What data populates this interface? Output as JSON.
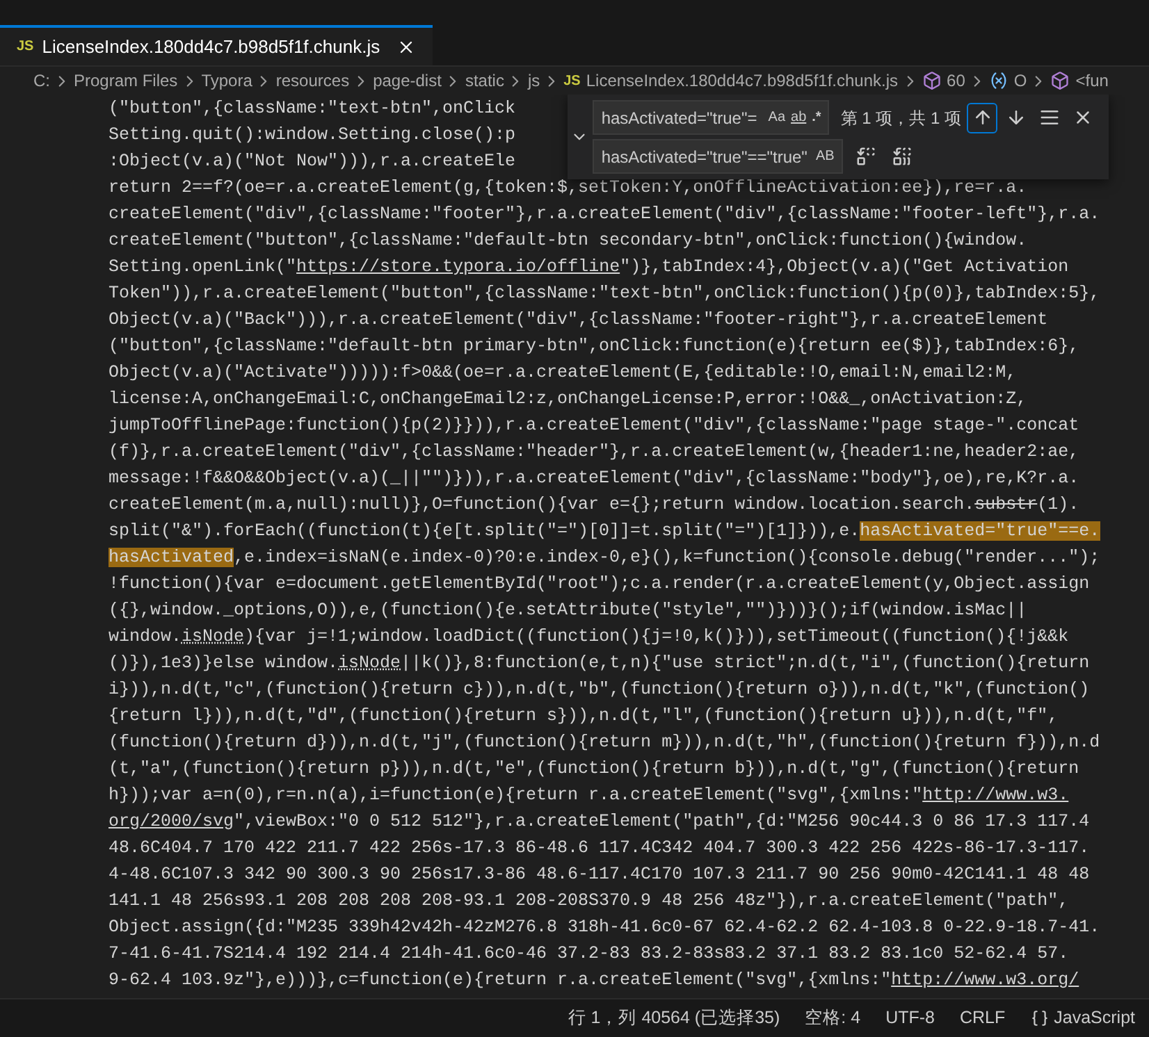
{
  "tab": {
    "label": "LicenseIndex.180dd4c7.b98d5f1f.chunk.js",
    "badge": "JS",
    "selected": true
  },
  "breadcrumbs": [
    {
      "label": "C:",
      "kind": "folder"
    },
    {
      "label": "Program Files",
      "kind": "folder"
    },
    {
      "label": "Typora",
      "kind": "folder"
    },
    {
      "label": "resources",
      "kind": "folder"
    },
    {
      "label": "page-dist",
      "kind": "folder"
    },
    {
      "label": "static",
      "kind": "folder"
    },
    {
      "label": "js",
      "kind": "folder"
    },
    {
      "label": "LicenseIndex.180dd4c7.b98d5f1f.chunk.js",
      "kind": "file",
      "badge": "JS"
    },
    {
      "label": "60",
      "kind": "module"
    },
    {
      "label": "O",
      "kind": "variable"
    },
    {
      "label": "<fun",
      "kind": "module"
    }
  ],
  "code_lines": [
    [
      {
        "text": "(\"button\",{className:\"text-btn\",onClick",
        "kind": "plain"
      }
    ],
    [
      {
        "text": "Setting.quit():window.Setting.close():p",
        "kind": "plain"
      }
    ],
    [
      {
        "text": ":Object(v.a)(\"Not Now\"))),r.a.createEle",
        "kind": "plain"
      }
    ],
    [
      {
        "text": "return 2==f?(oe=r.a.createElement(g,{token:$,setToken:Y,onOfflineActivation:ee}),re=r.a.",
        "kind": "plain"
      }
    ],
    [
      {
        "text": "createElement(\"div\",{className:\"footer\"},r.a.createElement(\"div\",{className:\"footer-left\"},r.a.",
        "kind": "plain"
      }
    ],
    [
      {
        "text": "createElement(\"button\",{className:\"default-btn secondary-btn\",onClick:function(){window.",
        "kind": "plain"
      }
    ],
    [
      {
        "text": "Setting.openLink(\"",
        "kind": "plain"
      },
      {
        "text": "https://store.typora.io/offline",
        "kind": "link"
      },
      {
        "text": "\")},tabIndex:4},Object(v.a)(\"Get Activation",
        "kind": "plain"
      }
    ],
    [
      {
        "text": "Token\")),r.a.createElement(\"button\",{className:\"text-btn\",onClick:function(){p(0)},tabIndex:5},",
        "kind": "plain"
      }
    ],
    [
      {
        "text": "Object(v.a)(\"Back\"))),r.a.createElement(\"div\",{className:\"footer-right\"},r.a.createElement",
        "kind": "plain"
      }
    ],
    [
      {
        "text": "(\"button\",{className:\"default-btn primary-btn\",onClick:function(e){return ee($)},tabIndex:6},",
        "kind": "plain"
      }
    ],
    [
      {
        "text": "Object(v.a)(\"Activate\"))))):f>0&&(oe=r.a.createElement(E,{editable:!O,email:N,email2:M,",
        "kind": "plain"
      }
    ],
    [
      {
        "text": "license:A,onChangeEmail:C,onChangeEmail2:z,onChangeLicense:P,error:!O&&_,onActivation:Z,",
        "kind": "plain"
      }
    ],
    [
      {
        "text": "jumpToOfflinePage:function(){p(2)}})),r.a.createElement(\"div\",{className:\"page stage-\".concat",
        "kind": "plain"
      }
    ],
    [
      {
        "text": "(f)},r.a.createElement(\"div\",{className:\"header\"},r.a.createElement(w,{header1:ne,header2:ae,",
        "kind": "plain"
      }
    ],
    [
      {
        "text": "message:!f&&O&&Object(v.a)(_||\"\")})),r.a.createElement(\"div\",{className:\"body\"},oe),re,K?r.a.",
        "kind": "plain"
      }
    ],
    [
      {
        "text": "createElement(m.a,null):null)},O=function(){var e={};return window.location.search.",
        "kind": "plain"
      },
      {
        "text": "substr",
        "kind": "deprecated"
      },
      {
        "text": "(1).",
        "kind": "plain"
      }
    ],
    [
      {
        "text": "split(\"&\").forEach((function(t){e[t.split(\"=\")[0]]=t.split(\"=\")[1]})),e.",
        "kind": "plain"
      },
      {
        "text": "hasActivated=\"true\"==e.",
        "kind": "match"
      }
    ],
    [
      {
        "text": "hasActivated",
        "kind": "match"
      },
      {
        "text": ",e.index=isNaN(e.index-0)?0:e.index-0,e}(),k=function(){console.debug(\"render...\");",
        "kind": "plain"
      }
    ],
    [
      {
        "text": "!function(){var e=document.getElementById(\"root\");c.a.render(r.a.createElement(y,Object.assign",
        "kind": "plain"
      }
    ],
    [
      {
        "text": "({},window._options,O)),e,(function(){e.setAttribute(\"style\",\"\")}))}();if(window.isMac||",
        "kind": "plain"
      }
    ],
    [
      {
        "text": "window.",
        "kind": "plain"
      },
      {
        "text": "isNode",
        "kind": "hint"
      },
      {
        "text": "){var j=!1;window.loadDict((function(){j=!0,k()})),setTimeout((function(){!j&&k",
        "kind": "plain"
      }
    ],
    [
      {
        "text": "()}),1e3)}else window.",
        "kind": "plain"
      },
      {
        "text": "isNode",
        "kind": "hint"
      },
      {
        "text": "||k()},8:function(e,t,n){\"use strict\";n.d(t,\"i\",(function(){return",
        "kind": "plain"
      }
    ],
    [
      {
        "text": "i})),n.d(t,\"c\",(function(){return c})),n.d(t,\"b\",(function(){return o})),n.d(t,\"k\",(function()",
        "kind": "plain"
      }
    ],
    [
      {
        "text": "{return l})),n.d(t,\"d\",(function(){return s})),n.d(t,\"l\",(function(){return u})),n.d(t,\"f\",",
        "kind": "plain"
      }
    ],
    [
      {
        "text": "(function(){return d})),n.d(t,\"j\",(function(){return m})),n.d(t,\"h\",(function(){return f})),n.d",
        "kind": "plain"
      }
    ],
    [
      {
        "text": "(t,\"a\",(function(){return p})),n.d(t,\"e\",(function(){return b})),n.d(t,\"g\",(function(){return",
        "kind": "plain"
      }
    ],
    [
      {
        "text": "h}));var a=n(0),r=n.n(a),i=function(e){return r.a.createElement(\"svg\",{xmlns:\"",
        "kind": "plain"
      },
      {
        "text": "http://www.w3.",
        "kind": "link"
      }
    ],
    [
      {
        "text": "org/2000/svg",
        "kind": "link"
      },
      {
        "text": "\",viewBox:\"0 0 512 512\"},r.a.createElement(\"path\",{d:\"M256 90c44.3 0 86 17.3 117.4",
        "kind": "plain"
      }
    ],
    [
      {
        "text": "48.6C404.7 170 422 211.7 422 256s-17.3 86-48.6 117.4C342 404.7 300.3 422 256 422s-86-17.3-117.",
        "kind": "plain"
      }
    ],
    [
      {
        "text": "4-48.6C107.3 342 90 300.3 90 256s17.3-86 48.6-117.4C170 107.3 211.7 90 256 90m0-42C141.1 48 48",
        "kind": "plain"
      }
    ],
    [
      {
        "text": "141.1 48 256s93.1 208 208 208 208-93.1 208-208S370.9 48 256 48z\"}),r.a.createElement(\"path\",",
        "kind": "plain"
      }
    ],
    [
      {
        "text": "Object.assign({d:\"M235 339h42v42h-42zM276.8 318h-41.6c0-67 62.4-62.2 62.4-103.8 0-22.9-18.7-41.",
        "kind": "plain"
      }
    ],
    [
      {
        "text": "7-41.6-41.7S214.4 192 214.4 214h-41.6c0-46 37.2-83 83.2-83s83.2 37.1 83.2 83.1c0 52-62.4 57.",
        "kind": "plain"
      }
    ],
    [
      {
        "text": "9-62.4 103.9z\"},e)))},c=function(e){return r.a.createElement(\"svg\",{xmlns:\"",
        "kind": "plain"
      },
      {
        "text": "http://www.w3.org/",
        "kind": "link"
      }
    ]
  ],
  "find_widget": {
    "expanded": true,
    "find_value": "hasActivated=\"true\"=",
    "find_options": [
      {
        "label": "Aa",
        "kind": "case",
        "selected": false
      },
      {
        "label": "ab",
        "kind": "word",
        "selected": false
      },
      {
        "label": ".*",
        "kind": "regex",
        "selected": false
      }
    ],
    "match_count": "第 1 项，共 1 项",
    "actions": [
      {
        "kind": "previous",
        "focused": true
      },
      {
        "kind": "next",
        "focused": false
      },
      {
        "kind": "selection",
        "focused": false
      },
      {
        "kind": "close",
        "focused": false
      }
    ],
    "replace_value": "hasActivated=\"true\"==\"true\"",
    "replace_options": [
      {
        "label": "AB",
        "kind": "preserve-case",
        "selected": false
      }
    ],
    "replace_actions": [
      {
        "kind": "replace"
      },
      {
        "kind": "replace-all"
      }
    ]
  },
  "status_bar": [
    {
      "label": "行 1，列 40564 (已选择35)",
      "kind": "text"
    },
    {
      "label": "空格: 4",
      "kind": "text"
    },
    {
      "label": "UTF-8",
      "kind": "text"
    },
    {
      "label": "CRLF",
      "kind": "text"
    },
    {
      "label": "JavaScript",
      "kind": "language"
    }
  ]
}
